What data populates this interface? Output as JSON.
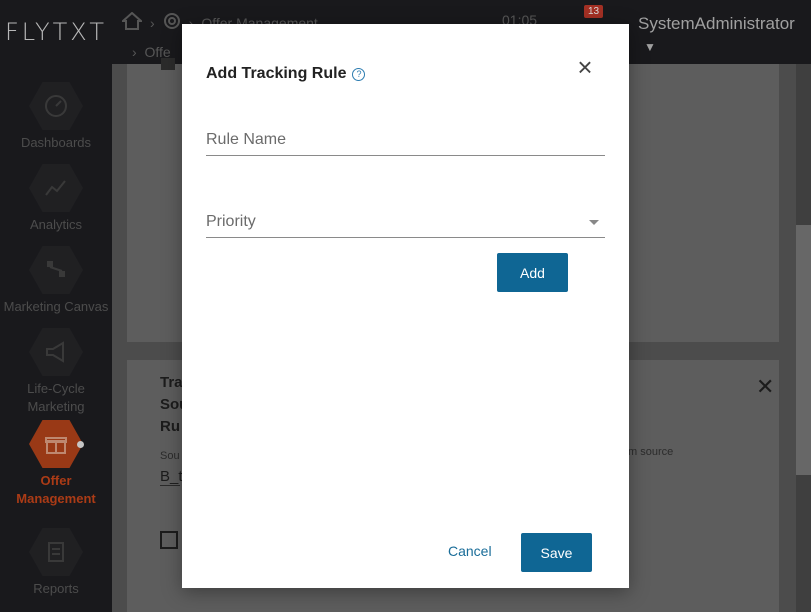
{
  "brand": {
    "logo": "FLYTXT"
  },
  "sidebar": {
    "items": [
      {
        "label": "Dashboards",
        "icon": "speedometer-icon"
      },
      {
        "label": "Analytics",
        "icon": "line-chart-icon"
      },
      {
        "label": "Marketing Canvas",
        "icon": "flow-canvas-icon"
      },
      {
        "label": "Life-Cycle Marketing",
        "icon": "megaphone-icon"
      },
      {
        "label": "Offer Management",
        "icon": "gift-icon",
        "active": true
      },
      {
        "label": "Reports",
        "icon": "report-icon"
      }
    ]
  },
  "header": {
    "breadcrumb": "Offer Management",
    "breadcrumb_sub": "Offe",
    "time": "01:05",
    "notification_count": "13",
    "user": "SystemAdministrator"
  },
  "background": {
    "section_title_lines": [
      "Tra",
      "Sou",
      "Ru"
    ],
    "source_label": "Sou",
    "source_value": "B_t",
    "from_source": "m source"
  },
  "modal": {
    "title": "Add Tracking Rule",
    "help_symbol": "?",
    "close_symbol": "×",
    "rule_name_placeholder": "Rule Name",
    "priority_placeholder": "Priority",
    "add_label": "Add",
    "cancel_label": "Cancel",
    "save_label": "Save"
  },
  "colors": {
    "accent": "#0f6694",
    "active_nav": "#b4441b",
    "badge": "#c0392b"
  }
}
